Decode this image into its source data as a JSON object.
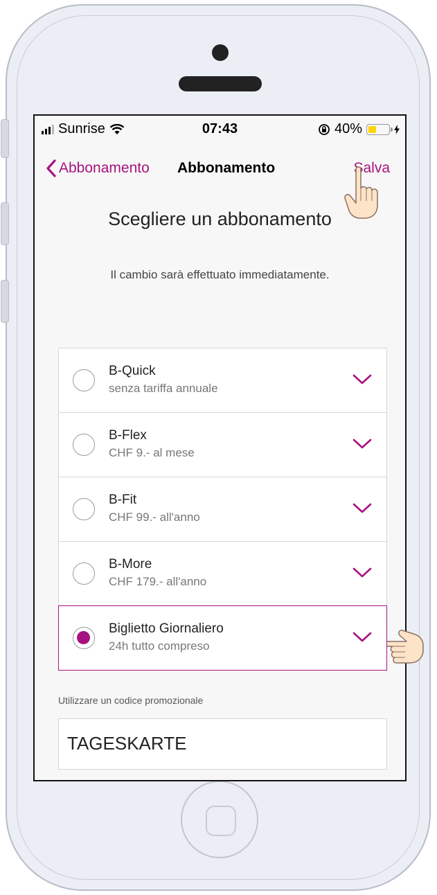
{
  "status_bar": {
    "carrier": "Sunrise",
    "time": "07:43",
    "battery_percent": "40%",
    "battery_level": 0.4,
    "icons": [
      "signal-icon",
      "wifi-icon",
      "rotation-lock-icon",
      "battery-icon",
      "charging-icon"
    ]
  },
  "nav": {
    "back_label": "Abbonamento",
    "title": "Abbonamento",
    "save_label": "Salva"
  },
  "content": {
    "heading": "Scegliere un abbonamento",
    "subtext": "Il cambio sarà effettuato immediatamente."
  },
  "plans": [
    {
      "name": "B-Quick",
      "desc": "senza tariffa annuale",
      "selected": false
    },
    {
      "name": "B-Flex",
      "desc": "CHF 9.- al mese",
      "selected": false
    },
    {
      "name": "B-Fit",
      "desc": "CHF 99.- all'anno",
      "selected": false
    },
    {
      "name": "B-More",
      "desc": "CHF 179.- all'anno",
      "selected": false
    },
    {
      "name": "Biglietto Giornaliero",
      "desc": "24h tutto compreso",
      "selected": true
    }
  ],
  "promo": {
    "label": "Utilizzare un codice promozionale",
    "value": "TAGESKARTE"
  },
  "colors": {
    "accent": "#a6127f",
    "battery": "#ffd400"
  }
}
